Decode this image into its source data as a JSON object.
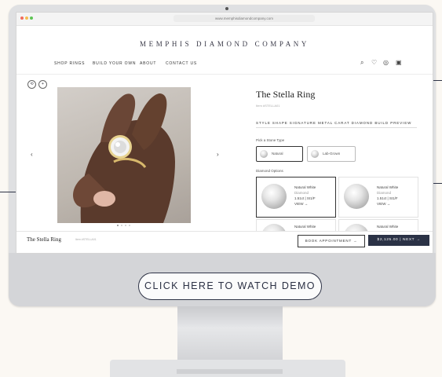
{
  "browser": {
    "url": "www.memphisdiamondcompany.com"
  },
  "brand": {
    "name": "MEMPHIS DIAMOND COMPANY"
  },
  "nav": {
    "items": [
      "SHOP RINGS",
      "BUILD YOUR OWN",
      "ABOUT",
      "CONTACT US"
    ]
  },
  "icons": [
    "search-icon",
    "heart-icon",
    "user-icon",
    "bag-icon"
  ],
  "product": {
    "title": "The Stella Ring",
    "subtitle": "Item #STELLA01",
    "steps": "STYLE  SHAPE  SIGNATURE  METAL  CARAT  DIAMOND  BUILD PREVIEW",
    "stone_type_label": "Pick a Stone Type",
    "stone_types": [
      "Natural",
      "Lab-Grown"
    ],
    "options_label": "Diamond Options",
    "options": [
      {
        "name": "Natural White",
        "sub": "Diamond",
        "spec": "1.51ct | SI1/F",
        "link": "VIEW →"
      },
      {
        "name": "Natural White",
        "sub": "Diamond",
        "spec": "1.51ct | SI1/F",
        "link": "VIEW →"
      },
      {
        "name": "Natural White",
        "sub": "",
        "spec": "",
        "link": ""
      },
      {
        "name": "Natural White",
        "sub": "",
        "spec": "",
        "link": ""
      }
    ]
  },
  "sticky": {
    "name": "The Stella Ring",
    "sub": "Item #STELLA01",
    "book": "BOOK APPOINTMENT →",
    "price": "$2,125.00  |  NEXT →"
  },
  "demo": {
    "label": "CLICK HERE TO WATCH DEMO"
  },
  "colors": {
    "accent": "#2e3447",
    "background": "#fbf8f3"
  }
}
